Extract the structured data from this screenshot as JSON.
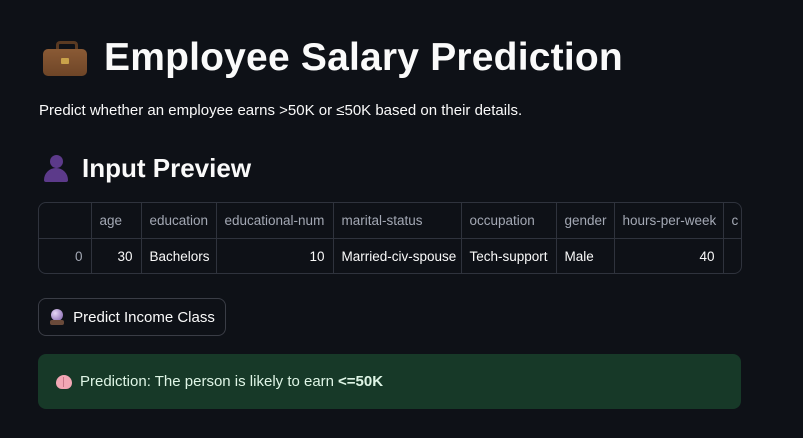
{
  "header": {
    "title": "Employee Salary Prediction",
    "icon": "briefcase-icon",
    "subtitle": "Predict whether an employee earns >50K or ≤50K based on their details."
  },
  "input_preview": {
    "title": "Input Preview",
    "icon": "person-silhouette-icon",
    "columns": [
      "",
      "age",
      "education",
      "educational-num",
      "marital-status",
      "occupation",
      "gender",
      "hours-per-week",
      "c"
    ],
    "rows": [
      [
        "0",
        "30",
        "Bachelors",
        "10",
        "Married-civ-spouse",
        "Tech-support",
        "Male",
        "40",
        ""
      ]
    ]
  },
  "predict_button": {
    "label": "Predict Income Class",
    "icon": "crystal-ball-icon"
  },
  "result": {
    "icon": "brain-icon",
    "text": "Prediction: The person is likely to earn",
    "value": "<=50K",
    "background_color": "#173928"
  },
  "colors": {
    "background": "#0e1117",
    "text": "#fafafa",
    "muted_text": "#a3a8b4",
    "border": "#2f333d"
  }
}
